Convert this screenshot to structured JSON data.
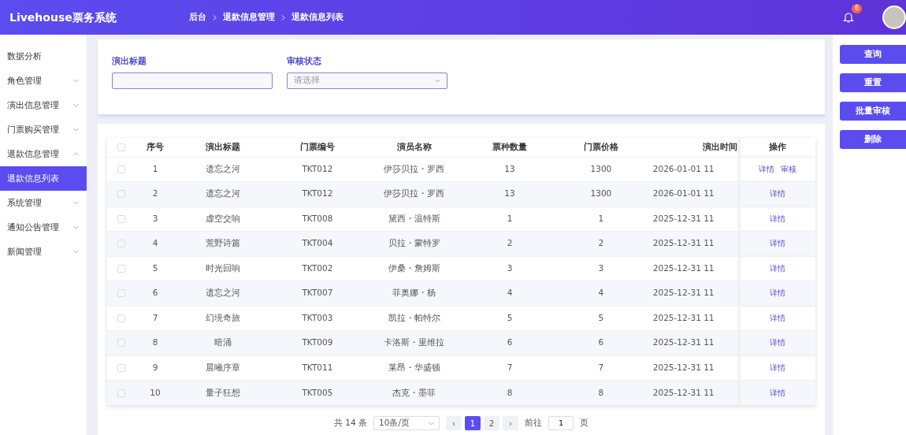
{
  "header": {
    "title": "Livehouse票务系统",
    "breadcrumb": [
      "后台",
      "退款信息管理",
      "退款信息列表"
    ],
    "notification_count": "6"
  },
  "sidebar": {
    "items": [
      {
        "kind": "link",
        "label": "数据分析",
        "selected": false
      },
      {
        "kind": "group",
        "label": "角色管理",
        "expanded": false
      },
      {
        "kind": "group",
        "label": "演出信息管理",
        "expanded": false
      },
      {
        "kind": "group",
        "label": "门票购买管理",
        "expanded": false
      },
      {
        "kind": "group",
        "label": "退款信息管理",
        "expanded": true,
        "children": [
          {
            "label": "退款信息列表",
            "selected": true
          }
        ]
      },
      {
        "kind": "group",
        "label": "系统管理",
        "expanded": false
      },
      {
        "kind": "group",
        "label": "通知公告管理",
        "expanded": false
      },
      {
        "kind": "group",
        "label": "新闻管理",
        "expanded": false
      }
    ]
  },
  "filters": [
    {
      "kind": "text",
      "label": "演出标题"
    },
    {
      "kind": "select",
      "label": "审核状态",
      "placeholder": "请选择"
    }
  ],
  "actions": [
    "查询",
    "重置",
    "批量审核",
    "删除"
  ],
  "table": {
    "select_all_checked": false,
    "columns": [
      "序号",
      "演出标题",
      "门票编号",
      "演员名称",
      "票种数量",
      "门票价格",
      "演出时间",
      "操作"
    ],
    "rows": [
      {
        "checked": false,
        "cells": [
          "1",
          "遗忘之河",
          "TKT012",
          "伊莎贝拉・罗西",
          "13",
          "1300",
          "2026-01-01 11"
        ],
        "operations": [
          "详情",
          "审核"
        ]
      },
      {
        "checked": false,
        "cells": [
          "2",
          "遗忘之河",
          "TKT012",
          "伊莎贝拉・罗西",
          "13",
          "1300",
          "2026-01-01 11"
        ],
        "operations": [
          "详情"
        ]
      },
      {
        "checked": false,
        "cells": [
          "3",
          "虚空交响",
          "TKT008",
          "黛西・温特斯",
          "1",
          "1",
          "2025-12-31 11"
        ],
        "operations": [
          "详情"
        ]
      },
      {
        "checked": false,
        "cells": [
          "4",
          "荒野诗篇",
          "TKT004",
          "贝拉・蒙特罗",
          "2",
          "2",
          "2025-12-31 11"
        ],
        "operations": [
          "详情"
        ]
      },
      {
        "checked": false,
        "cells": [
          "5",
          "时光回响",
          "TKT002",
          "伊桑・詹姆斯",
          "3",
          "3",
          "2025-12-31 11"
        ],
        "operations": [
          "详情"
        ]
      },
      {
        "checked": false,
        "cells": [
          "6",
          "遗忘之河",
          "TKT007",
          "菲奥娜・杨",
          "4",
          "4",
          "2025-12-31 11"
        ],
        "operations": [
          "详情"
        ]
      },
      {
        "checked": false,
        "cells": [
          "7",
          "幻境奇旅",
          "TKT003",
          "凯拉・帕特尔",
          "5",
          "5",
          "2025-12-31 11"
        ],
        "operations": [
          "详情"
        ]
      },
      {
        "checked": false,
        "cells": [
          "8",
          "暗涌",
          "TKT009",
          "卡洛斯・里维拉",
          "6",
          "6",
          "2025-12-31 11"
        ],
        "operations": [
          "详情"
        ]
      },
      {
        "checked": false,
        "cells": [
          "9",
          "晨曦序章",
          "TKT011",
          "莱昂・华盛顿",
          "7",
          "7",
          "2025-12-31 11"
        ],
        "operations": [
          "详情"
        ]
      },
      {
        "checked": false,
        "cells": [
          "10",
          "量子狂想",
          "TKT005",
          "杰克・墨菲",
          "8",
          "8",
          "2025-12-31 11"
        ],
        "operations": [
          "详情"
        ]
      }
    ]
  },
  "pagination": {
    "total": "共 14 条",
    "page_size": "10条/页",
    "prev": "‹",
    "pages": [
      {
        "label": "1",
        "selected": true
      },
      {
        "label": "2",
        "selected": false
      }
    ],
    "next": "›",
    "goto_label": "前往",
    "goto_value": "1",
    "goto_suffix": "页"
  }
}
